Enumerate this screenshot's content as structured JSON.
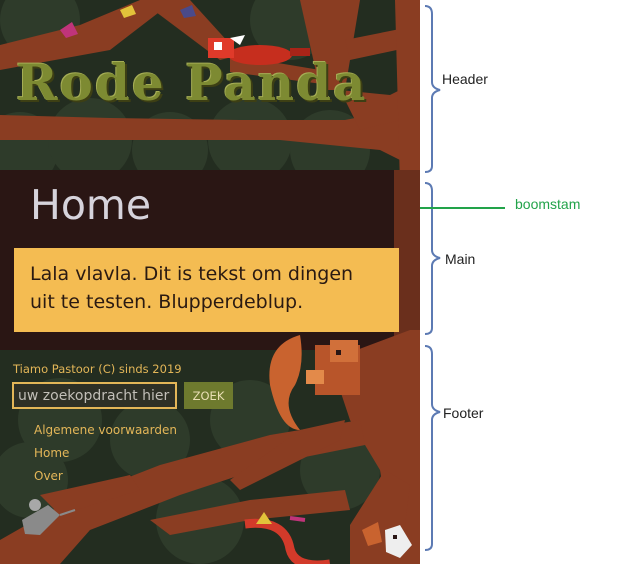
{
  "header": {
    "logo": "Rode Panda"
  },
  "main": {
    "title": "Home",
    "content": "Lala vlavla. Dit is tekst om dingen uit te testen. Blupperdeblup."
  },
  "footer": {
    "copyright": "Tiamo Pastoor (C) sinds 2019",
    "search": {
      "placeholder": "uw zoekopdracht hier",
      "button_label": "ZOEK"
    },
    "links": [
      "Algemene voorwaarden",
      "Home",
      "Over"
    ]
  },
  "annotations": {
    "header": "Header",
    "boomstam": "boomstam",
    "main": "Main",
    "footer": "Footer"
  },
  "colors": {
    "background": "#232d20",
    "tree_bark": "#8a3d22",
    "content_box": "#f4bc52",
    "accent_text": "#e3b658",
    "logo": "#7d8a32",
    "button": "#6e7a2e",
    "bracket": "#5c7ab3",
    "boomstam_line": "#22a34a"
  },
  "icons": [
    "red-panda-icon",
    "squirrel-icon",
    "mouse-icon",
    "snake-icon",
    "bird-icon",
    "butterfly-icon"
  ]
}
